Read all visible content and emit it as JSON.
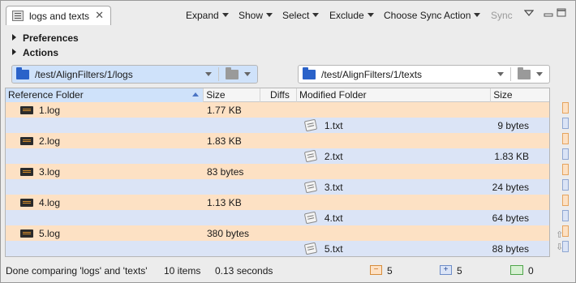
{
  "tab": {
    "title": "logs and texts",
    "close": "✕"
  },
  "toolbar": {
    "expand": "Expand",
    "show": "Show",
    "select": "Select",
    "exclude": "Exclude",
    "choose_sync_action": "Choose Sync Action",
    "sync": "Sync"
  },
  "panels": {
    "preferences": "Preferences",
    "actions": "Actions"
  },
  "left_path": "/test/AlignFilters/1/logs",
  "right_path": "/test/AlignFilters/1/texts",
  "columns": {
    "reference_folder": "Reference Folder",
    "size": "Size",
    "diffs": "Diffs",
    "modified_folder": "Modified Folder",
    "size2": "Size"
  },
  "rows": [
    {
      "side": "ref",
      "name": "1.log",
      "size": "1.77 KB"
    },
    {
      "side": "mod",
      "name": "1.txt",
      "size": "9 bytes"
    },
    {
      "side": "ref",
      "name": "2.log",
      "size": "1.83 KB"
    },
    {
      "side": "mod",
      "name": "2.txt",
      "size": "1.83 KB"
    },
    {
      "side": "ref",
      "name": "3.log",
      "size": "83 bytes"
    },
    {
      "side": "mod",
      "name": "3.txt",
      "size": "24 bytes"
    },
    {
      "side": "ref",
      "name": "4.log",
      "size": "1.13 KB"
    },
    {
      "side": "mod",
      "name": "4.txt",
      "size": "64 bytes"
    },
    {
      "side": "ref",
      "name": "5.log",
      "size": "380 bytes"
    },
    {
      "side": "mod",
      "name": "5.txt",
      "size": "88 bytes"
    }
  ],
  "status": {
    "message": "Done comparing 'logs' and 'texts'",
    "items": "10 items",
    "time": "0.13 seconds",
    "removed_symbol": "−",
    "removed_count": "5",
    "added_symbol": "+",
    "added_count": "5",
    "changed_count": "0"
  },
  "colors": {
    "reference_row": "#fde1c4",
    "modified_row": "#dbe4f6",
    "selection": "#cfe2fa",
    "folder_icon": "#2a62c9"
  }
}
